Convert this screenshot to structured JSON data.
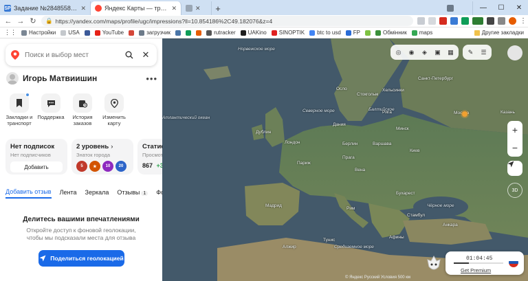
{
  "browser": {
    "tabs": [
      {
        "title": "Задание №2848558 - просмотр з",
        "favicon_text": "SP",
        "favicon_color": "#3a7bd5",
        "active": false
      },
      {
        "title": "Яндекс Карты — транспорт, нави",
        "favicon_text": "",
        "favicon_color": "#ff4433",
        "active": true
      },
      {
        "title": "",
        "favicon_text": "",
        "favicon_color": "#9aa7b5",
        "active": false
      },
      {
        "title": "",
        "favicon_text": "",
        "favicon_color": "#6c7a89",
        "active": false
      }
    ],
    "new_tab_label": "+",
    "address": "https://yandex.com/maps/profile/ugc/impressions?ll=10.854186%2C49.182076&z=4",
    "bookmarks": [
      {
        "label": "Настройки",
        "color": "#7b8794"
      },
      {
        "label": "USA",
        "color": "#c4c8cc"
      },
      {
        "label": "",
        "color": "#3b5998"
      },
      {
        "label": "YouTube",
        "color": "#e62117"
      },
      {
        "label": "",
        "color": "#d44638"
      },
      {
        "label": "загрузчик",
        "color": "#6c7a89"
      },
      {
        "label": "",
        "color": "#4a76a8"
      },
      {
        "label": "",
        "color": "#0f9d58"
      },
      {
        "label": "",
        "color": "#e65c00"
      },
      {
        "label": "rutracker",
        "color": "#555"
      },
      {
        "label": "UAKino",
        "color": "#1e1e1e"
      },
      {
        "label": "SINOPTIK",
        "color": "#e02020"
      },
      {
        "label": "btc to usd",
        "color": "#4285f4"
      },
      {
        "label": "FP",
        "color": "#2a6cd6"
      },
      {
        "label": "",
        "color": "#7ec242"
      },
      {
        "label": "Обмінник",
        "color": "#3a8f3a"
      },
      {
        "label": "maps",
        "color": "#34a853"
      }
    ],
    "other_bookmarks": "Другие закладки"
  },
  "sidebar": {
    "search_placeholder": "Поиск и выбор мест",
    "user_name": "Игорь Матвиишин",
    "actions": [
      {
        "label": "Закладки и транспорт",
        "icon": "bookmark-icon",
        "dot": true
      },
      {
        "label": "Поддержка",
        "icon": "chat-icon",
        "dot": false
      },
      {
        "label": "История заказов",
        "icon": "history-icon",
        "dot": false
      },
      {
        "label": "Изменить карту",
        "icon": "map-pin-icon",
        "dot": false
      }
    ],
    "cards": {
      "subscriptions": {
        "title": "Нет подписок",
        "subtitle": "Нет подписчиков",
        "button": "Добавить"
      },
      "level": {
        "title": "2 уровень",
        "subtitle": "Знаток города",
        "badges": [
          "5",
          "★",
          "10",
          "20"
        ]
      },
      "stats": {
        "title": "Статист",
        "subtitle": "Просмотр",
        "value": "867",
        "delta": "+3"
      }
    },
    "tabs": [
      {
        "label": "Добавить отзыв",
        "active": true
      },
      {
        "label": "Лента",
        "active": false
      },
      {
        "label": "Зеркала",
        "active": false
      },
      {
        "label": "Отзывы",
        "active": false,
        "count": "1"
      },
      {
        "label": "Фото",
        "active": false
      }
    ],
    "share": {
      "heading": "Делитесь вашими впечатлениями",
      "text": "Откройте доступ к фоновой геолокации, чтобы мы подсказали места для отзыва",
      "button": "Поделиться геолокацией"
    }
  },
  "map": {
    "labels": {
      "atlantic": "Атлантический океан",
      "north_sea": "Северное море",
      "norwegian": "Норвежское море",
      "baltic": "Балтийское",
      "med": "Средиземное море",
      "black": "Чёрное море",
      "st_petersburg": "Санкт-Петербург",
      "moscow": "Москва",
      "london": "Лондон",
      "dublin": "Дублин",
      "paris": "Париж",
      "berlin": "Берлин",
      "warsaw": "Варшава",
      "kyiv": "Киев",
      "minsk": "Минск",
      "riga": "Рига",
      "stockholm": "Стокгольм",
      "oslo": "Осло",
      "helsinki": "Хельсинки",
      "madrid": "Мадрид",
      "rome": "Рим",
      "vienna": "Вена",
      "istanbul": "Стамбул",
      "athens": "Афины",
      "kazan": "Казань",
      "algiers": "Алжир",
      "tunis": "Тунис",
      "ankara": "Анкара",
      "bucharest": "Бухарест",
      "prague": "Прага",
      "denmark": "Дания"
    },
    "credits": "© Яндекс  Русский  Условия  500 км",
    "promo": {
      "timer": "01:04:45",
      "link": "Get Premium",
      "progress": 0.3
    }
  }
}
